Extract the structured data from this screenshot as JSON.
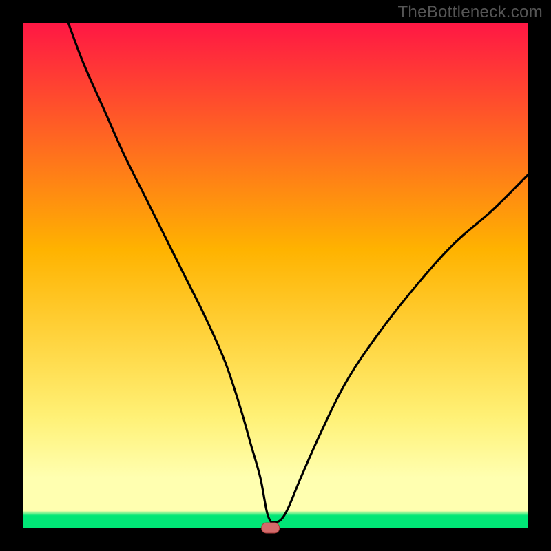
{
  "watermark": "TheBottleneck.com",
  "colors": {
    "frame": "#000000",
    "grad_top": "#ff1744",
    "grad_mid1": "#ffb300",
    "grad_mid2": "#fff176",
    "grad_low": "#ffffb0",
    "grad_green": "#00e676",
    "curve": "#000000",
    "marker_fill": "#d46a6a",
    "marker_stroke": "#a83a3a"
  },
  "chart_data": {
    "type": "line",
    "title": "",
    "xlabel": "",
    "ylabel": "",
    "xlim": [
      0,
      100
    ],
    "ylim": [
      0,
      100
    ],
    "marker": {
      "x": 49,
      "y": 0
    },
    "series": [
      {
        "name": "bottleneck-curve",
        "x": [
          9,
          12,
          16,
          20,
          24,
          28,
          32,
          36,
          40,
          43,
          45,
          47,
          48.5,
          50,
          52,
          55,
          59,
          64,
          70,
          77,
          85,
          93,
          100
        ],
        "values": [
          100,
          92,
          83,
          74,
          66,
          58,
          50,
          42,
          33,
          24,
          17,
          10,
          2.5,
          1.2,
          3,
          10,
          19,
          29,
          38,
          47,
          56,
          63,
          70
        ]
      }
    ]
  }
}
